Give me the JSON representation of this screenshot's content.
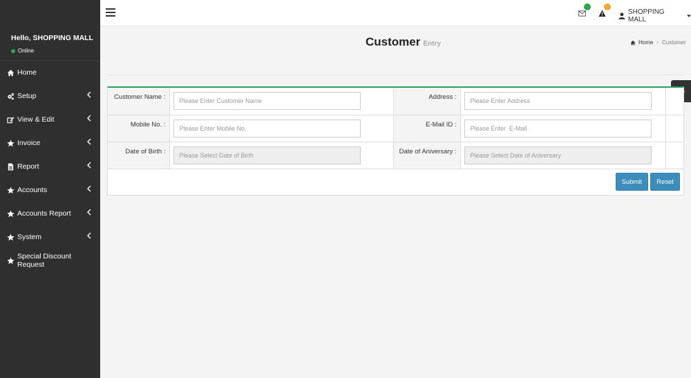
{
  "sidebar": {
    "greeting": "Hello, SHOPPING MALL",
    "status": "Online",
    "items": [
      {
        "label": "Home",
        "icon": "home-icon",
        "has_submenu": false
      },
      {
        "label": "Setup",
        "icon": "cogs-icon",
        "has_submenu": true
      },
      {
        "label": "View & Edit",
        "icon": "edit-icon",
        "has_submenu": true
      },
      {
        "label": "Invoice",
        "icon": "star-icon",
        "has_submenu": true
      },
      {
        "label": "Report",
        "icon": "file-icon",
        "has_submenu": true
      },
      {
        "label": "Accounts",
        "icon": "star-icon",
        "has_submenu": true
      },
      {
        "label": "Accounts Report",
        "icon": "star-icon",
        "has_submenu": true
      },
      {
        "label": "System",
        "icon": "star-icon",
        "has_submenu": true
      },
      {
        "label": "Special Discount Request",
        "icon": "star-icon",
        "has_submenu": false
      }
    ]
  },
  "topbar": {
    "user_label": "SHOPPING MALL",
    "colors": {
      "mail_badge": "#2fa64a",
      "alert_badge": "#f0a830"
    }
  },
  "page": {
    "title": "Customer",
    "subtitle": "Entry",
    "breadcrumb": {
      "home": "Home",
      "current": "Customer"
    }
  },
  "form": {
    "customer_name_label": "Customer Name :",
    "customer_name_placeholder": "Please Enter Customer Name",
    "address_label": "Address :",
    "address_placeholder": "Please Enter Address",
    "mobile_label": "Mobile No. :",
    "mobile_placeholder": "Please Enter Mobile No.",
    "email_label": "E-Mail ID :",
    "email_placeholder": "Please Enter  E-Mail",
    "dob_label": "Date of Birth :",
    "dob_placeholder": "Please Select Date of Birth",
    "anniversary_label": "Date of Aniversary :",
    "anniversary_placeholder": "Please Select Date of Aniversary",
    "submit_label": "Submit",
    "reset_label": "Reset"
  },
  "colors": {
    "sidebar_bg": "#2f2f2f",
    "accent": "#3c8dbc",
    "panel_border": "#27a35c"
  }
}
